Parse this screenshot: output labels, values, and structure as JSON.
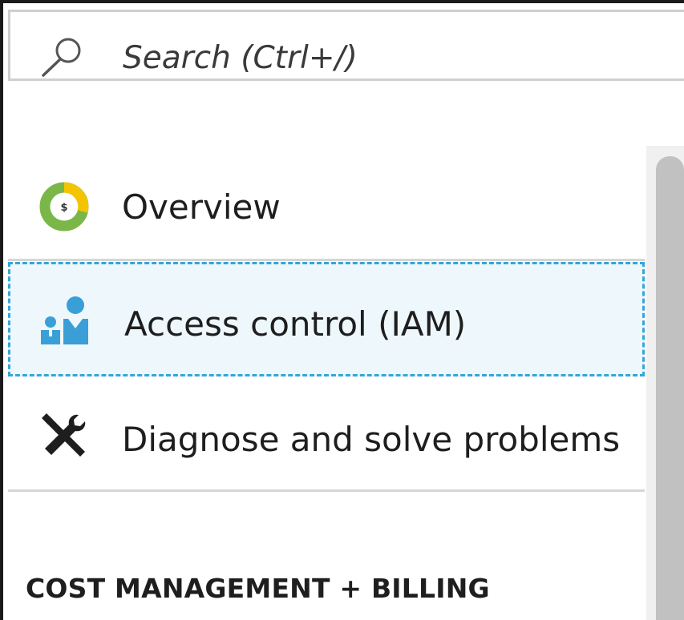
{
  "search": {
    "placeholder": "Search (Ctrl+/)",
    "icon": "search-icon"
  },
  "nav": {
    "items": [
      {
        "label": "Overview",
        "icon": "cost-overview-icon",
        "selected": false
      },
      {
        "label": "Access control (IAM)",
        "icon": "access-control-icon",
        "selected": true
      },
      {
        "label": "Diagnose and solve problems",
        "icon": "wrench-screwdriver-icon",
        "selected": false
      }
    ]
  },
  "sections": [
    {
      "title": "COST MANAGEMENT + BILLING"
    }
  ],
  "colors": {
    "selected_background": "#eef8fc",
    "selected_border": "#34a6d8",
    "iam_icon": "#3a9fd6",
    "overview_green": "#7ab648",
    "overview_yellow": "#f5c400"
  }
}
